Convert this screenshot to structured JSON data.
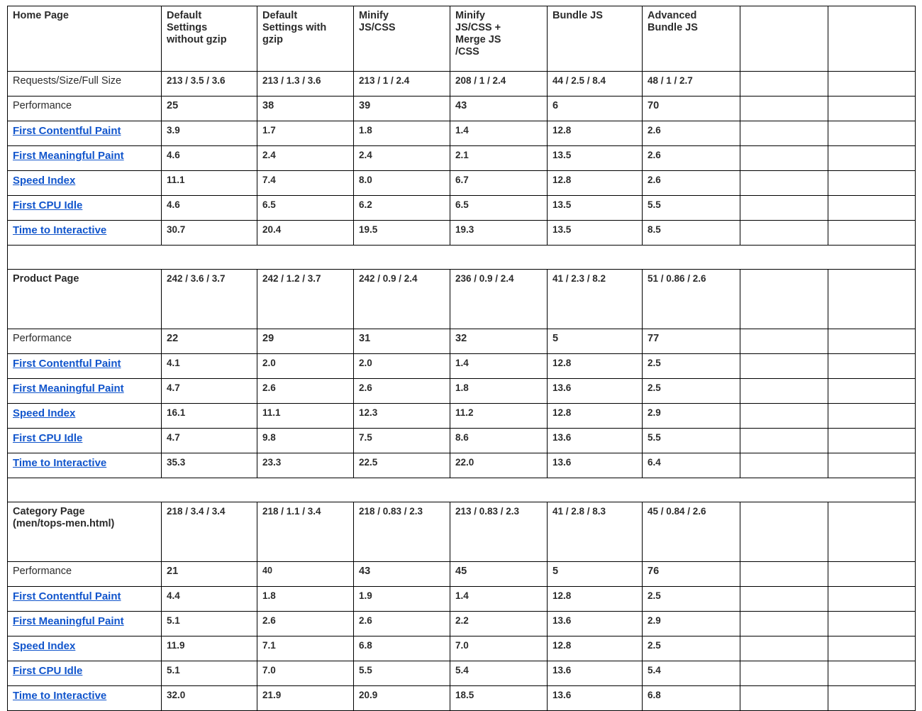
{
  "table": {
    "columns": [
      "",
      "Default Settings without  gzip",
      "Default Settings with gzip",
      "Minify JS/CSS",
      "Minify JS/CSS + Merge JS /CSS",
      "Bundle JS",
      "Advanced Bundle JS",
      "",
      ""
    ],
    "column_headers_multiline": [
      [
        "Default",
        "Settings",
        "without  gzip"
      ],
      [
        "Default",
        "Settings with",
        "gzip"
      ],
      [
        "Minify",
        "JS/CSS"
      ],
      [
        "Minify",
        "JS/CSS +",
        "Merge JS",
        "/CSS"
      ],
      [
        "Bundle JS"
      ],
      [
        "Advanced",
        "Bundle JS"
      ]
    ],
    "colors": {
      "good": "#1d7a3e",
      "medium": "#e8890c",
      "bad": "#a32638",
      "link": "#1155cc",
      "text": "#1f1f1f",
      "border": "#000000"
    }
  },
  "sections": [
    {
      "id": "home-page",
      "title": "Home Page",
      "title_line2": "",
      "has_requests_label_row": true,
      "requests_label": "Requests/Size/Full Size",
      "requests_values": [
        "213 / 3.5 / 3.6",
        "213 / 1.3 / 3.6",
        "213 / 1 / 2.4",
        "208 / 1 / 2.4",
        "44 / 2.5 / 8.4",
        "48 / 1 / 2.7",
        "",
        ""
      ],
      "performance_label": "Performance",
      "performance_values": [
        {
          "text": "25",
          "color": "dark"
        },
        {
          "text": "38",
          "color": "dark"
        },
        {
          "text": "39",
          "color": "dark"
        },
        {
          "text": "43",
          "color": "dark"
        },
        {
          "text": "6",
          "color": "dark"
        },
        {
          "text": "70",
          "color": "dark"
        },
        {
          "text": "",
          "color": "dark"
        },
        {
          "text": "",
          "color": "dark"
        }
      ],
      "metrics": [
        {
          "label": "First Contentful Paint",
          "values": [
            {
              "text": "3.9",
              "color": "medium"
            },
            {
              "text": "1.7",
              "color": "good"
            },
            {
              "text": "1.8",
              "color": "good"
            },
            {
              "text": "1.4",
              "color": "good"
            },
            {
              "text": "12.8",
              "color": "bad"
            },
            {
              "text": "2.6",
              "color": "medium"
            },
            {
              "text": "",
              "color": "dark"
            },
            {
              "text": "",
              "color": "dark"
            }
          ]
        },
        {
          "label": "First Meaningful Paint",
          "values": [
            {
              "text": "4.6",
              "color": "bad"
            },
            {
              "text": "2.4",
              "color": "medium"
            },
            {
              "text": "2.4",
              "color": "medium"
            },
            {
              "text": "2.1",
              "color": "good"
            },
            {
              "text": "13.5",
              "color": "bad"
            },
            {
              "text": "2.6",
              "color": "medium"
            },
            {
              "text": "",
              "color": "dark"
            },
            {
              "text": "",
              "color": "dark"
            }
          ]
        },
        {
          "label": "Speed Index",
          "values": [
            {
              "text": "11.1",
              "color": "bad"
            },
            {
              "text": "7.4",
              "color": "bad"
            },
            {
              "text": "8.0",
              "color": "bad"
            },
            {
              "text": "6.7",
              "color": "bad"
            },
            {
              "text": "12.8",
              "color": "bad"
            },
            {
              "text": "2.6",
              "color": "good"
            },
            {
              "text": "",
              "color": "dark"
            },
            {
              "text": "",
              "color": "dark"
            }
          ]
        },
        {
          "label": "First CPU Idle",
          "values": [
            {
              "text": "4.6",
              "color": "medium"
            },
            {
              "text": "6.5",
              "color": "medium"
            },
            {
              "text": "6.2",
              "color": "medium"
            },
            {
              "text": "6.5",
              "color": "bad"
            },
            {
              "text": "13.5",
              "color": "bad"
            },
            {
              "text": "5.5",
              "color": "medium"
            },
            {
              "text": "",
              "color": "dark"
            },
            {
              "text": "",
              "color": "dark"
            }
          ]
        },
        {
          "label": "Time to Interactive",
          "values": [
            {
              "text": "30.7",
              "color": "bad"
            },
            {
              "text": "20.4",
              "color": "bad"
            },
            {
              "text": "19.5",
              "color": "bad"
            },
            {
              "text": "19.3",
              "color": "bad"
            },
            {
              "text": "13.5",
              "color": "bad"
            },
            {
              "text": "8.5",
              "color": "bad"
            },
            {
              "text": "",
              "color": "dark"
            },
            {
              "text": "",
              "color": "dark"
            }
          ]
        }
      ]
    },
    {
      "id": "product-page",
      "title": "Product Page",
      "title_line2": "",
      "has_requests_label_row": false,
      "requests_label": "",
      "requests_values": [
        "242 / 3.6 / 3.7",
        "242 / 1.2 / 3.7",
        "242 / 0.9 / 2.4",
        "236 / 0.9 / 2.4",
        "41 / 2.3 / 8.2",
        "51 / 0.86 / 2.6",
        "",
        ""
      ],
      "performance_label": "Performance",
      "performance_values": [
        {
          "text": "22",
          "color": "dark"
        },
        {
          "text": "29",
          "color": "dark"
        },
        {
          "text": "31",
          "color": "dark"
        },
        {
          "text": "32",
          "color": "dark"
        },
        {
          "text": "5",
          "color": "dark"
        },
        {
          "text": "77",
          "color": "dark"
        },
        {
          "text": "",
          "color": "dark"
        },
        {
          "text": "",
          "color": "dark"
        }
      ],
      "metrics": [
        {
          "label": "First Contentful Paint",
          "values": [
            {
              "text": "4.1",
              "color": "bad"
            },
            {
              "text": "2.0",
              "color": "good"
            },
            {
              "text": "2.0",
              "color": "good"
            },
            {
              "text": "1.4",
              "color": "good"
            },
            {
              "text": "12.8",
              "color": "bad"
            },
            {
              "text": "2.5",
              "color": "medium"
            },
            {
              "text": "",
              "color": "dark"
            },
            {
              "text": "",
              "color": "dark"
            }
          ]
        },
        {
          "label": "First Meaningful Paint",
          "values": [
            {
              "text": "4.7",
              "color": "bad"
            },
            {
              "text": "2.6",
              "color": "medium"
            },
            {
              "text": "2.6",
              "color": "medium"
            },
            {
              "text": "1.8",
              "color": "good"
            },
            {
              "text": "13.6",
              "color": "bad"
            },
            {
              "text": "2.5",
              "color": "medium"
            },
            {
              "text": "",
              "color": "dark"
            },
            {
              "text": "",
              "color": "dark"
            }
          ]
        },
        {
          "label": "Speed Index",
          "values": [
            {
              "text": "16.1",
              "color": "bad"
            },
            {
              "text": "11.1",
              "color": "bad"
            },
            {
              "text": "12.3",
              "color": "bad"
            },
            {
              "text": "11.2",
              "color": "bad"
            },
            {
              "text": "12.8",
              "color": "bad"
            },
            {
              "text": "2.9",
              "color": "good"
            },
            {
              "text": "",
              "color": "dark"
            },
            {
              "text": "",
              "color": "dark"
            }
          ]
        },
        {
          "label": "First CPU Idle",
          "values": [
            {
              "text": "4.7",
              "color": "medium"
            },
            {
              "text": "9.8",
              "color": "bad"
            },
            {
              "text": "7.5",
              "color": "bad"
            },
            {
              "text": "8.6",
              "color": "bad"
            },
            {
              "text": "13.6",
              "color": "bad"
            },
            {
              "text": "5.5",
              "color": "medium"
            },
            {
              "text": "",
              "color": "dark"
            },
            {
              "text": "",
              "color": "dark"
            }
          ]
        },
        {
          "label": "Time to Interactive",
          "values": [
            {
              "text": "35.3",
              "color": "bad"
            },
            {
              "text": "23.3",
              "color": "bad"
            },
            {
              "text": "22.5",
              "color": "bad"
            },
            {
              "text": "22.0",
              "color": "bad"
            },
            {
              "text": "13.6",
              "color": "bad"
            },
            {
              "text": "6.4",
              "color": "medium"
            },
            {
              "text": "",
              "color": "dark"
            },
            {
              "text": "",
              "color": "dark"
            }
          ]
        }
      ]
    },
    {
      "id": "category-page",
      "title": "Category Page",
      "title_line2": "(men/tops-men.html)",
      "has_requests_label_row": false,
      "requests_label": "",
      "requests_values": [
        "218 / 3.4 / 3.4",
        "218 / 1.1 / 3.4",
        "218 / 0.83 / 2.3",
        "213 / 0.83 / 2.3",
        "41 / 2.8 / 8.3",
        "45 / 0.84 / 2.6",
        "",
        ""
      ],
      "performance_label": "Performance",
      "performance_values": [
        {
          "text": "21",
          "color": "dark"
        },
        {
          "text": "40",
          "color": "good",
          "small": true
        },
        {
          "text": "43",
          "color": "dark"
        },
        {
          "text": "45",
          "color": "dark"
        },
        {
          "text": "5",
          "color": "dark"
        },
        {
          "text": "76",
          "color": "dark"
        },
        {
          "text": "",
          "color": "dark"
        },
        {
          "text": "",
          "color": "dark"
        }
      ],
      "metrics": [
        {
          "label": "First Contentful Paint",
          "values": [
            {
              "text": "4.4",
              "color": "bad"
            },
            {
              "text": "1.8",
              "color": "good"
            },
            {
              "text": "1.9",
              "color": "good"
            },
            {
              "text": "1.4",
              "color": "good"
            },
            {
              "text": "12.8",
              "color": "bad"
            },
            {
              "text": "2.5",
              "color": "medium"
            },
            {
              "text": "",
              "color": "dark"
            },
            {
              "text": "",
              "color": "dark"
            }
          ]
        },
        {
          "label": "First Meaningful Paint",
          "values": [
            {
              "text": "5.1",
              "color": "bad"
            },
            {
              "text": "2.6",
              "color": "medium"
            },
            {
              "text": "2.6",
              "color": "medium"
            },
            {
              "text": "2.2",
              "color": "good"
            },
            {
              "text": "13.6",
              "color": "bad"
            },
            {
              "text": "2.9",
              "color": "medium"
            },
            {
              "text": "",
              "color": "dark"
            },
            {
              "text": "",
              "color": "dark"
            }
          ]
        },
        {
          "label": "Speed Index",
          "values": [
            {
              "text": "11.9",
              "color": "bad"
            },
            {
              "text": "7.1",
              "color": "bad"
            },
            {
              "text": "6.8",
              "color": "bad"
            },
            {
              "text": "7.0",
              "color": "bad"
            },
            {
              "text": "12.8",
              "color": "bad"
            },
            {
              "text": "2.5",
              "color": "good"
            },
            {
              "text": "",
              "color": "dark"
            },
            {
              "text": "",
              "color": "dark"
            }
          ]
        },
        {
          "label": "First CPU Idle",
          "values": [
            {
              "text": "5.1",
              "color": "medium"
            },
            {
              "text": "7.0",
              "color": "bad"
            },
            {
              "text": "5.5",
              "color": "medium"
            },
            {
              "text": "5.4",
              "color": "medium"
            },
            {
              "text": "13.6",
              "color": "bad"
            },
            {
              "text": "5.4",
              "color": "medium"
            },
            {
              "text": "",
              "color": "dark"
            },
            {
              "text": "",
              "color": "dark"
            }
          ]
        },
        {
          "label": "Time to Interactive",
          "values": [
            {
              "text": "32.0",
              "color": "bad"
            },
            {
              "text": "21.9",
              "color": "bad"
            },
            {
              "text": "20.9",
              "color": "bad"
            },
            {
              "text": "18.5",
              "color": "bad"
            },
            {
              "text": "13.6",
              "color": "bad"
            },
            {
              "text": "6.8",
              "color": "medium"
            },
            {
              "text": "",
              "color": "dark"
            },
            {
              "text": "",
              "color": "dark"
            }
          ]
        }
      ]
    }
  ]
}
